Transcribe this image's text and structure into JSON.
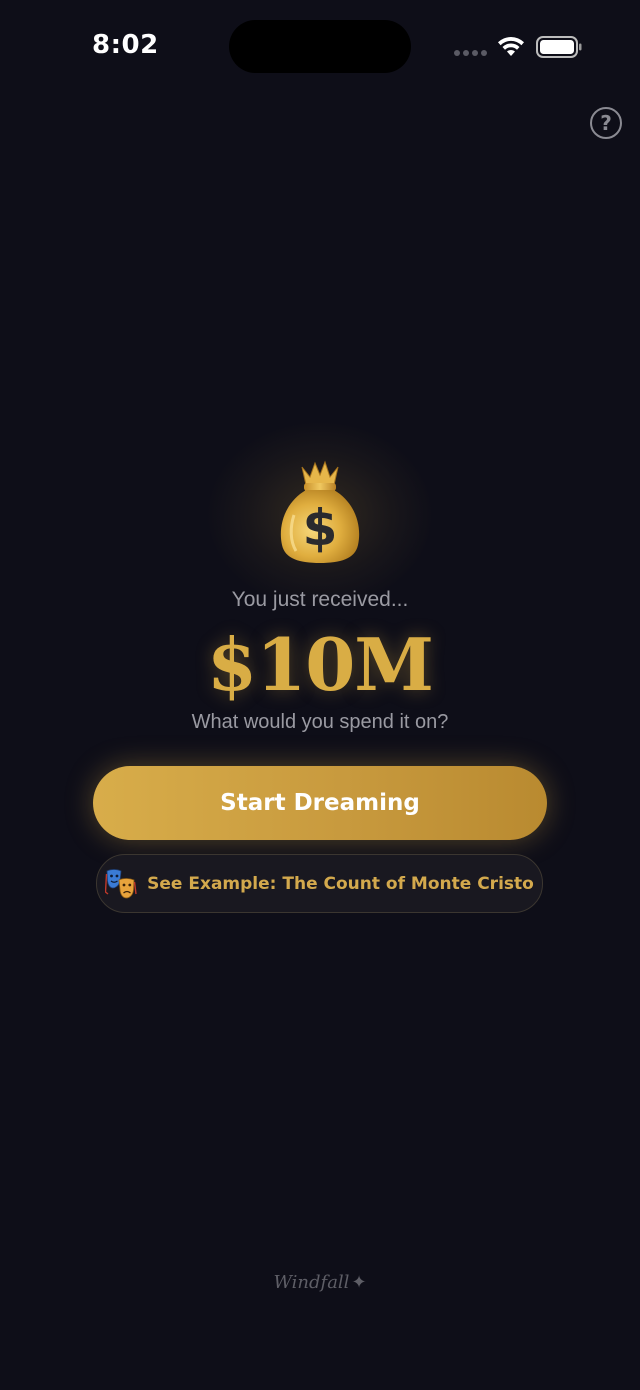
{
  "status_bar": {
    "time": "8:02"
  },
  "help": {
    "label": "?"
  },
  "hero": {
    "icon": "money-bag-icon",
    "subtitle": "You just received...",
    "amount": "$10M",
    "question": "What would you spend it on?"
  },
  "actions": {
    "start_label": "Start Dreaming",
    "example_icon": "theater-masks-icon",
    "example_label": "See Example: The Count of Monte Cristo"
  },
  "footer": {
    "brand": "Windfall",
    "brand_mark": "✦"
  },
  "colors": {
    "background": "#0e0e18",
    "accent_gold": "#d9ad45",
    "muted_text": "#9a9aa2"
  }
}
